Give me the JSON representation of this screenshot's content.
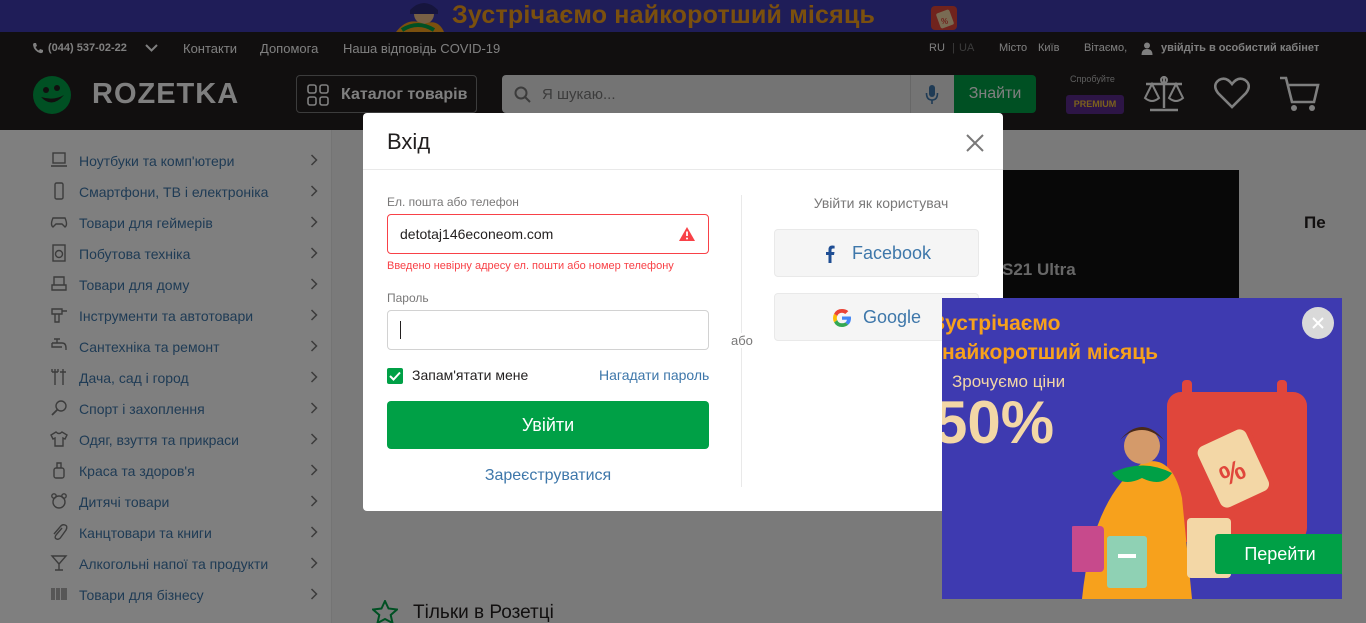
{
  "promo_banner": {
    "text": "Зустрічаємо найкоротший місяць"
  },
  "header": {
    "phone": "(044) 537-02-22",
    "links": [
      "Контакти",
      "Допомога",
      "Наша відповідь COVID-19"
    ],
    "lang_ru": "RU",
    "lang_sep": "|",
    "lang_ua": "UA",
    "city_label": "Місто",
    "city": "Київ",
    "greeting": "Вітаємо,",
    "login_link": "увійдіть в особистий кабінет",
    "logo": "ROZETKA",
    "catalog_label": "Каталог товарів",
    "search_placeholder": "Я шукаю...",
    "search_button": "Знайти",
    "try_label": "Спробуйте",
    "premium_label": "PREMIUM"
  },
  "sidebar": {
    "items": [
      {
        "label": "Ноутбуки та комп'ютери",
        "icon": "laptop-icon"
      },
      {
        "label": "Смартфони, ТВ і електроніка",
        "icon": "smartphone-icon"
      },
      {
        "label": "Товари для геймерів",
        "icon": "gamepad-icon"
      },
      {
        "label": "Побутова техніка",
        "icon": "washing-machine-icon"
      },
      {
        "label": "Товари для дому",
        "icon": "armchair-icon"
      },
      {
        "label": "Інструменти та автотовари",
        "icon": "drill-icon"
      },
      {
        "label": "Сантехніка та ремонт",
        "icon": "faucet-icon"
      },
      {
        "label": "Дача, сад і город",
        "icon": "garden-tools-icon"
      },
      {
        "label": "Спорт і захоплення",
        "icon": "racket-icon"
      },
      {
        "label": "Одяг, взуття та прикраси",
        "icon": "tshirt-icon"
      },
      {
        "label": "Краса та здоров'я",
        "icon": "cosmetics-icon"
      },
      {
        "label": "Дитячі товари",
        "icon": "teddy-bear-icon"
      },
      {
        "label": "Канцтовари та книги",
        "icon": "paperclip-icon"
      },
      {
        "label": "Алкогольні напої та продукти",
        "icon": "cocktail-icon"
      },
      {
        "label": "Товари для бізнесу",
        "icon": "barcode-icon"
      }
    ]
  },
  "main": {
    "section_title": "Тільки в Розетці",
    "banner_partial_text": "S21 Ultra",
    "right_partial_text": "Пе"
  },
  "login_modal": {
    "title": "Вхід",
    "email_label": "Ел. пошта або телефон",
    "email_value": "detotaj146econeom.com",
    "email_error": "Введено невірну адресу ел. пошти або номер телефону",
    "password_label": "Пароль",
    "password_value": "",
    "remember_label": "Запам'ятати мене",
    "remember_checked": true,
    "remind_link": "Нагадати пароль",
    "submit_label": "Увійти",
    "register_link": "Зареєструватися",
    "or_label": "або",
    "social_title": "Увійти як користувач",
    "facebook_label": "Facebook",
    "google_label": "Google"
  },
  "side_promo": {
    "line1": "Зустрічаємо",
    "line2": "найкоротший місяць",
    "subtitle": "Зрочуємо ціни",
    "discount": "50%",
    "button": "Перейти"
  },
  "colors": {
    "header_bg": "#221f1f",
    "accent_green": "#00a046",
    "link_blue": "#3e77aa",
    "error_red": "#f84147",
    "promo_blue": "#3e3ab0",
    "promo_orange": "#f7a11c"
  }
}
